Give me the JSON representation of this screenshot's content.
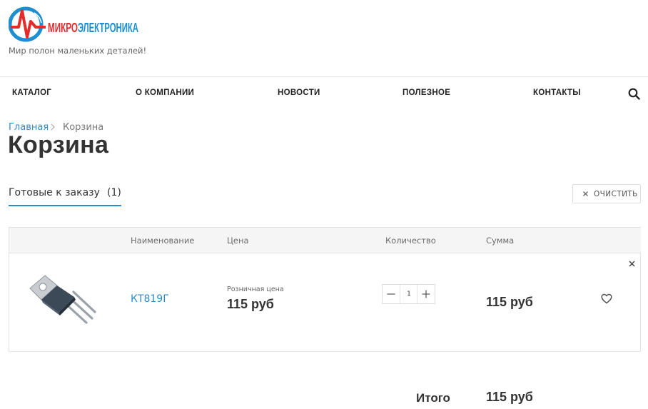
{
  "brand": {
    "name_red": "МИКРО",
    "name_blue": "ЭЛЕКТРОНИКА",
    "tagline": "Мир полон маленьких деталей!"
  },
  "nav": {
    "items": [
      {
        "label": "КАТАЛОГ"
      },
      {
        "label": "О КОМПАНИИ"
      },
      {
        "label": "НОВОСТИ"
      },
      {
        "label": "ПОЛЕЗНОЕ"
      },
      {
        "label": "КОНТАКТЫ"
      }
    ],
    "search_icon": "search-icon"
  },
  "breadcrumb": {
    "home": "Главная",
    "current": "Корзина"
  },
  "page": {
    "title": "Корзина"
  },
  "tabs": {
    "ready": {
      "label": "Готовые к заказу",
      "count": "(1)"
    }
  },
  "actions": {
    "clear_label": "ОЧИСТИТЬ"
  },
  "table": {
    "headers": {
      "name": "Наименование",
      "price": "Цена",
      "quantity": "Количество",
      "sum": "Сумма"
    },
    "rows": [
      {
        "name": "КТ819Г",
        "price_label": "Розничная цена",
        "price": "115 руб",
        "quantity": "1",
        "sum": "115 руб"
      }
    ]
  },
  "totals": {
    "label": "Итого",
    "value": "115 руб"
  },
  "colors": {
    "accent": "#2e8bc9",
    "brand_red": "#e42c2c",
    "brand_blue": "#1d8fd1"
  }
}
